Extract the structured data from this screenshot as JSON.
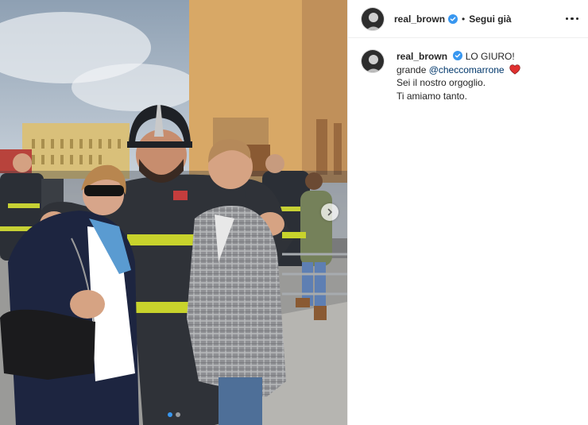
{
  "post": {
    "author": {
      "username": "real_brown",
      "verified": true,
      "verified_badge_color": "#3897f0"
    },
    "header": {
      "separator": "•",
      "follow_label": "Segui già",
      "more_icon": "three-dots-icon"
    },
    "caption": {
      "first_line": "LO GIURO!",
      "second_line_prefix": "grande ",
      "mention": "@checcomarrone",
      "heart_emoji_color": "#ed4956",
      "third_line": "Sei il nostro orgoglio.",
      "fourth_line": "Ti amiamo tanto."
    },
    "media": {
      "carousel_count": 2,
      "carousel_active_index": 0,
      "next_icon": "chevron-right-icon"
    }
  }
}
